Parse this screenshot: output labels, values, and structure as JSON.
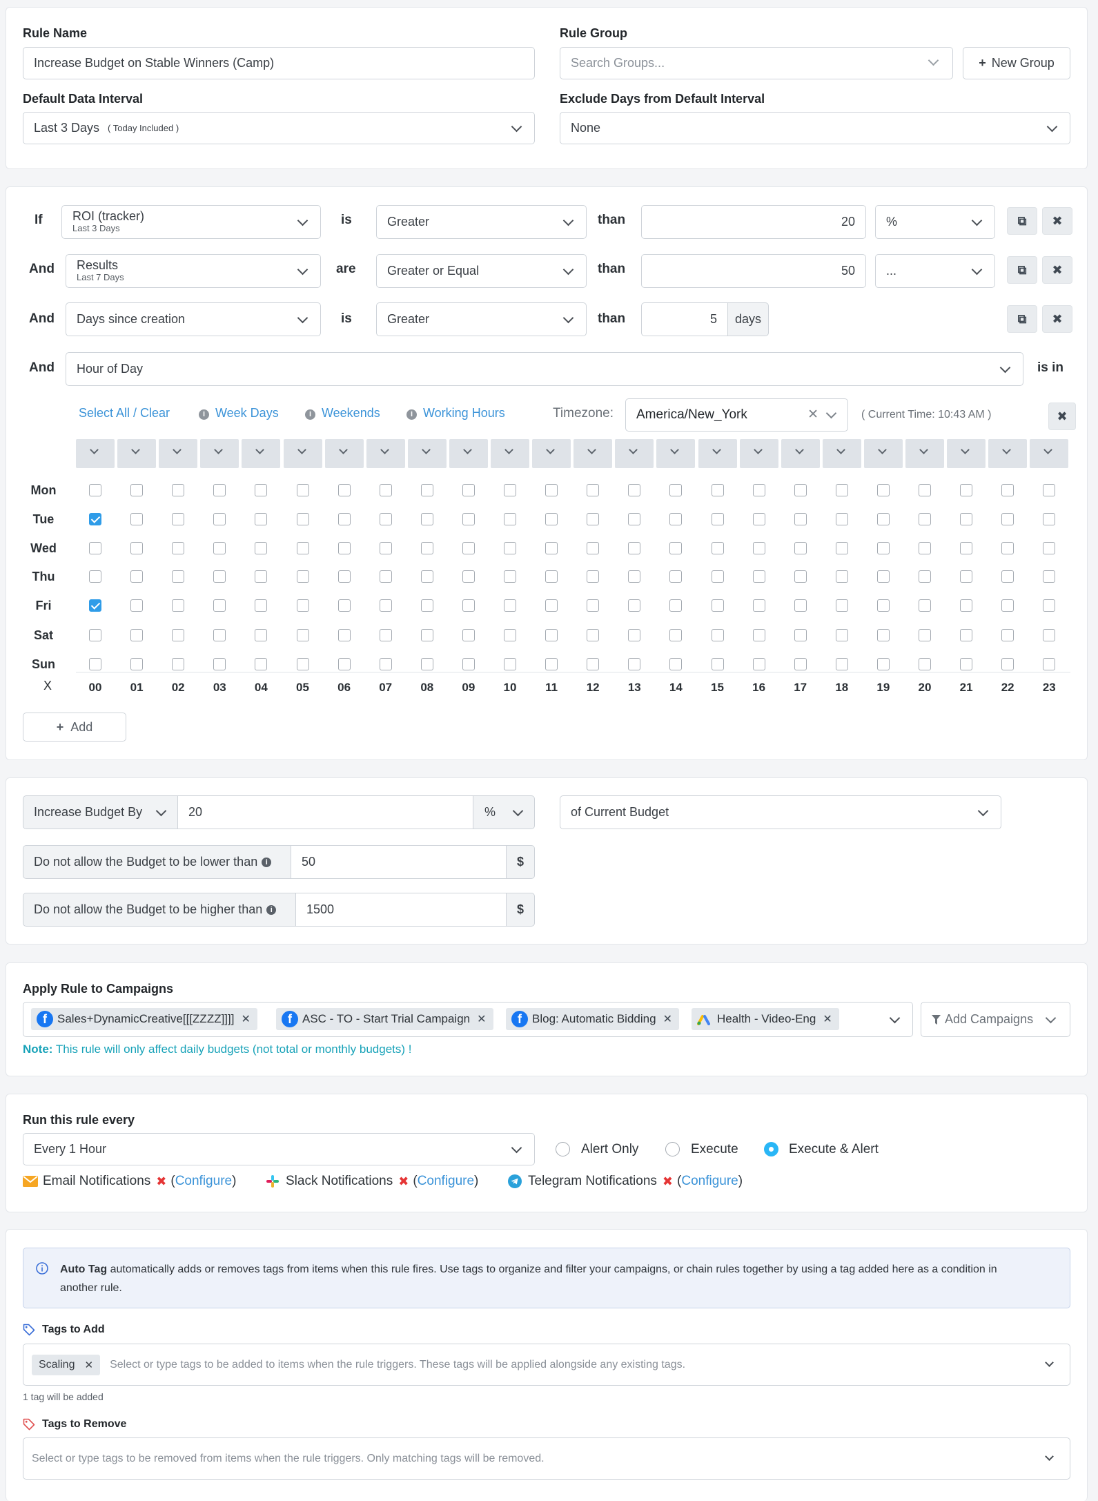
{
  "rule": {
    "name_label": "Rule Name",
    "name_value": "Increase Budget on Stable Winners (Camp)",
    "group_label": "Rule Group",
    "group_placeholder": "Search Groups...",
    "new_group": "New Group",
    "interval_label": "Default Data Interval",
    "interval_value": "Last 3 Days",
    "interval_note": "( Today Included )",
    "exclude_label": "Exclude Days from Default Interval",
    "exclude_value": "None"
  },
  "conditions": {
    "rows": [
      {
        "connector": "If",
        "metric": "ROI (tracker)",
        "metric_sub": "Last 3 Days",
        "verb": "is",
        "operator": "Greater",
        "than": "than",
        "value": "20",
        "unit": "%"
      },
      {
        "connector": "And",
        "metric": "Results",
        "metric_sub": "Last 7 Days",
        "verb": "are",
        "operator": "Greater or Equal",
        "than": "than",
        "value": "50",
        "unit": "..."
      },
      {
        "connector": "And",
        "metric": "Days since creation",
        "verb": "is",
        "operator": "Greater",
        "than": "than",
        "value": "5",
        "unit": "days"
      }
    ],
    "hour_row": {
      "connector": "And",
      "metric": "Hour of Day",
      "suffix": "is in"
    },
    "schedule": {
      "select_all": "Select All / Clear",
      "week_days": "Week Days",
      "weekends": "Weekends",
      "working_hours": "Working Hours",
      "timezone_label": "Timezone:",
      "timezone_value": "America/New_York",
      "current_time": "( Current Time: 10:43 AM )",
      "days": [
        "Mon",
        "Tue",
        "Wed",
        "Thu",
        "Fri",
        "Sat",
        "Sun"
      ],
      "hours": [
        "00",
        "01",
        "02",
        "03",
        "04",
        "05",
        "06",
        "07",
        "08",
        "09",
        "10",
        "11",
        "12",
        "13",
        "14",
        "15",
        "16",
        "17",
        "18",
        "19",
        "20",
        "21",
        "22",
        "23"
      ],
      "corner": "X",
      "checked": [
        [
          1,
          0
        ],
        [
          4,
          0
        ]
      ]
    },
    "add_label": "Add"
  },
  "action": {
    "type": "Increase Budget By",
    "value": "20",
    "unit": "%",
    "basis": "of Current Budget",
    "min_label": "Do not allow the Budget to be lower than",
    "min_value": "50",
    "min_unit": "$",
    "max_label": "Do not allow the Budget to be higher than",
    "max_value": "1500",
    "max_unit": "$"
  },
  "campaigns": {
    "label": "Apply Rule to Campaigns",
    "items": [
      {
        "name": "Sales+DynamicCreative[[[ZZZZ]]]]",
        "icon": "facebook-icon"
      },
      {
        "name": "ASC - TO - Start Trial Campaign",
        "icon": "facebook-icon"
      },
      {
        "name": "Blog: Automatic Bidding",
        "icon": "facebook-icon"
      },
      {
        "name": "Health - Video-Eng",
        "icon": "google-ads-icon"
      }
    ],
    "add_campaigns": "Add Campaigns",
    "note_prefix": "Note:",
    "note_text": "This rule will only affect daily budgets (not total or monthly budgets) !"
  },
  "schedule_run": {
    "label": "Run this rule every",
    "value": "Every 1 Hour",
    "options": [
      "Alert Only",
      "Execute",
      "Execute & Alert"
    ],
    "selected": "Execute & Alert",
    "email": "Email Notifications",
    "slack": "Slack Notifications",
    "telegram": "Telegram Notifications",
    "configure": "Configure",
    "open_paren": "(",
    "close_paren": ")"
  },
  "tags": {
    "info_bold": "Auto Tag",
    "info_text": " automatically adds or removes tags from items when this rule fires. Use tags to organize and filter your campaigns, or chain rules together by using a tag added here as a condition in another rule.",
    "add_label": "Tags to Add",
    "add_chip": "Scaling",
    "add_placeholder": "Select or type tags to be added to items when the rule triggers. These tags will be applied alongside any existing tags.",
    "add_count": "1 tag will be added",
    "remove_label": "Tags to Remove",
    "remove_placeholder": "Select or type tags to be removed from items when the rule triggers. Only matching tags will be removed."
  },
  "colors": {
    "accent": "#3b93d8",
    "check": "#2f9ce8",
    "radio": "#29b6f6",
    "danger": "#e53535",
    "note": "#17a2b8"
  }
}
